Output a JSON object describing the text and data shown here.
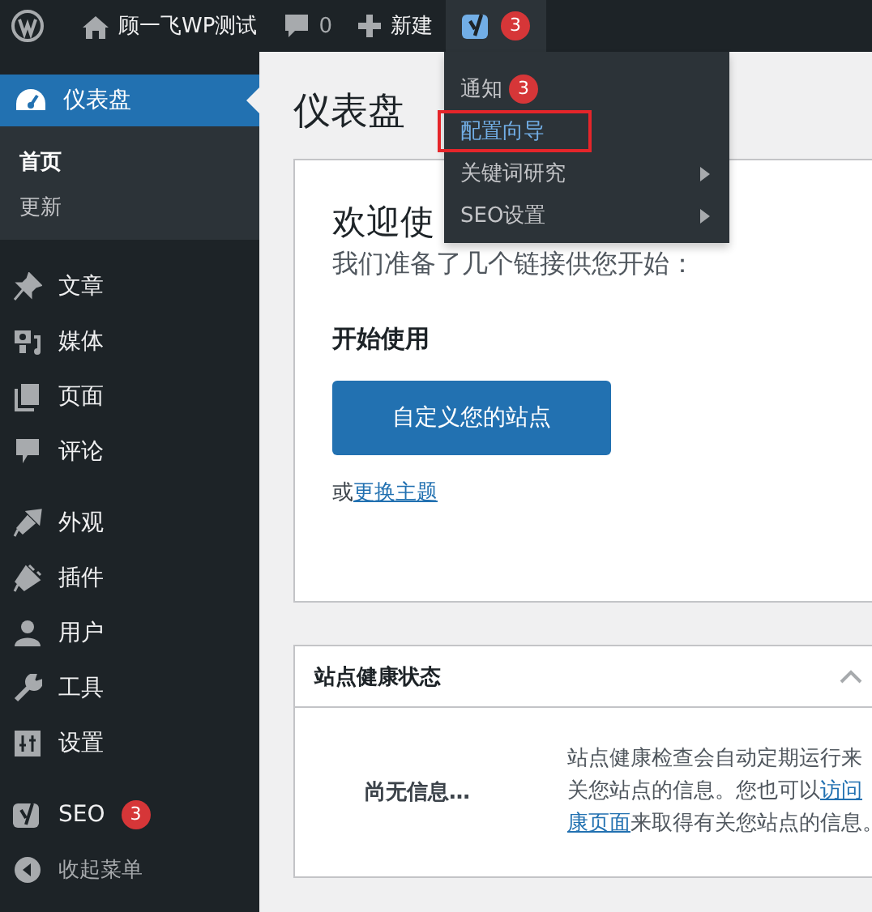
{
  "admin_bar": {
    "site_name": "顾一飞WP测试",
    "comments_count": "0",
    "new_label": "新建",
    "seo_badge": "3",
    "seo_open": true
  },
  "seo_menu": [
    {
      "label": "通知",
      "badge": "3",
      "submenu": false,
      "outlined": false,
      "selected": false
    },
    {
      "label": "配置向导",
      "submenu": false,
      "outlined": true,
      "selected": true
    },
    {
      "label": "关键词研究",
      "submenu": true,
      "outlined": false,
      "selected": false
    },
    {
      "label": "SEO设置",
      "submenu": true,
      "outlined": false,
      "selected": false
    }
  ],
  "sidebar": {
    "current": {
      "label": "仪表盘",
      "submenu": [
        {
          "label": "首页",
          "selected": true
        },
        {
          "label": "更新",
          "selected": false
        }
      ]
    },
    "groups": [
      [
        {
          "label": "文章"
        },
        {
          "label": "媒体"
        },
        {
          "label": "页面"
        },
        {
          "label": "评论"
        }
      ],
      [
        {
          "label": "外观"
        },
        {
          "label": "插件"
        },
        {
          "label": "用户"
        },
        {
          "label": "工具"
        },
        {
          "label": "设置"
        }
      ],
      [
        {
          "label": "SEO",
          "badge": "3"
        },
        {
          "label": "收起菜单",
          "kind": "collapse"
        }
      ]
    ]
  },
  "page_title": "仪表盘",
  "welcome": {
    "title": "欢迎使",
    "subtitle": "我们准备了几个链接供您开始：",
    "heading": "开始使用",
    "button": "自定义您的站点",
    "alt_prefix": "或",
    "alt_link": "更换主题"
  },
  "site_health": {
    "title": "站点健康状态",
    "expanded": true,
    "status": "尚无信息…",
    "lines": [
      [
        {
          "text": "站点健康检查会自动定期运行来",
          "link": false
        }
      ],
      [
        {
          "text": "关您站点的信息。您也可以",
          "link": false
        },
        {
          "text": "访问",
          "link": true
        }
      ],
      [
        {
          "text": "康页面",
          "link": true
        },
        {
          "text": "来取得有关您站点的信息。",
          "link": false
        }
      ]
    ]
  }
}
